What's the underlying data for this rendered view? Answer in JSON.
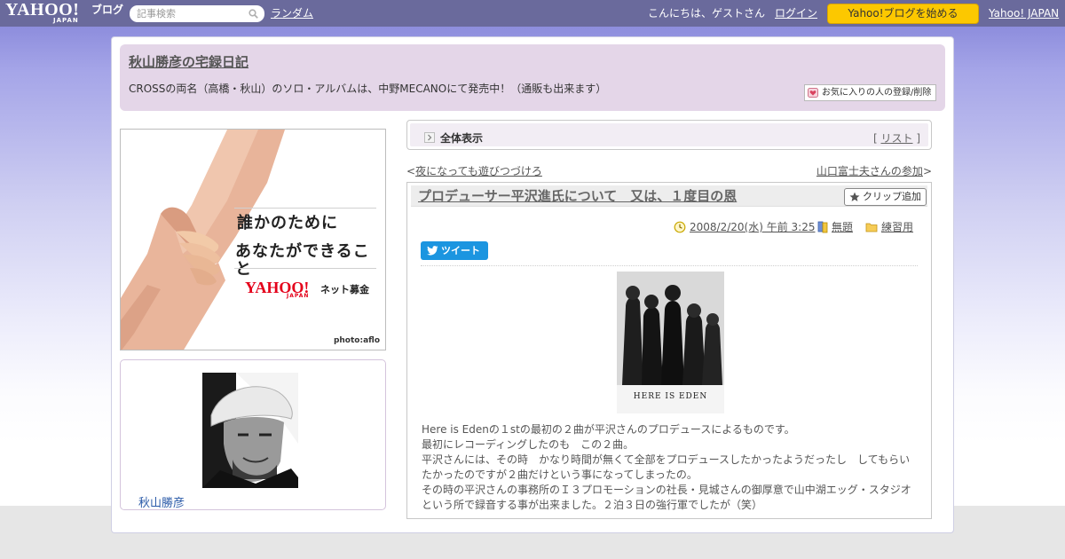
{
  "masthead": {
    "logo_text": "YAHOO!",
    "logo_sub": "JAPAN",
    "logo_blog": "ブログ",
    "search_placeholder": "記事検索",
    "random_link": "ランダム",
    "greeting": "こんにちは、ゲストさん",
    "login_link": "ログイン",
    "start_button": "Yahoo!ブログを始める",
    "yahoo_japan_link": "Yahoo! JAPAN"
  },
  "blog": {
    "title": "秋山勝彦の宅録日記",
    "description": "CROSSの両名（高橋・秋山）のソロ・アルバムは、中野MECANOにて発売中！（通販も出来ます）",
    "favorite_button": "お気に入りの人の登録/削除"
  },
  "ad": {
    "line1": "誰かのために",
    "line2": "あなたができること",
    "brand": "YAHOO!",
    "brand_sub": "JAPAN",
    "service": "ネット募金",
    "credit": "photo:aflo"
  },
  "profile": {
    "name": "秋山勝彦"
  },
  "view_bar": {
    "label": "全体表示",
    "list_prefix": "[ ",
    "list_link": "リスト",
    "list_suffix": " ]"
  },
  "pager": {
    "prev_marker": "<",
    "prev_link": "夜になっても遊びつづけろ",
    "next_link": "山口富士夫さんの参加",
    "next_marker": ">"
  },
  "article": {
    "title": "プロデューサー平沢進氏について　又は、１度目の恩",
    "clip_button": "クリップ追加",
    "date": "2008/2/20(水) 午前 3:25",
    "theme": "無題",
    "category": "練習用",
    "tweet_button": "ツイート",
    "cover_caption": "HERE IS EDEN",
    "body": [
      "Here is Edenの１stの最初の２曲が平沢さんのプロデュースによるものです。",
      "最初にレコーディングしたのも　この２曲。",
      "平沢さんには、その時　かなり時間が無くて全部をプロデュースしたかったようだったし　してもらい",
      "たかったのですが２曲だけという事になってしまったの。",
      "その時の平沢さんの事務所のＩ３プロモーションの社長・見城さんの御厚意で山中湖エッグ・スタジオ",
      "という所で録音する事が出来ました。２泊３日の強行軍でしたが（笑）"
    ]
  },
  "colors": {
    "masthead_bg": "#6a6a9c",
    "blog_header_bg": "#e4d6e8",
    "start_button_bg": "#fcc800",
    "tweet_button_bg": "#1b95e0",
    "profile_name": "#2a5aa8"
  },
  "icons": [
    "search-icon",
    "heart-icon",
    "all-view-icon",
    "star-icon",
    "clock-icon",
    "book-icon",
    "folder-icon",
    "twitter-bird-icon"
  ]
}
